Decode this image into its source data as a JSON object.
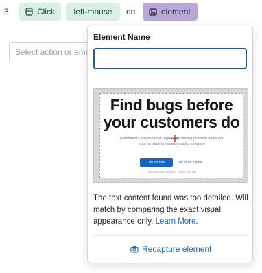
{
  "step": {
    "number": "3",
    "click_label": "Click",
    "mouse_label": "left-mouse",
    "on_label": "on",
    "element_label": "element"
  },
  "action_select": {
    "placeholder": "Select action or emi"
  },
  "popover": {
    "title": "Element Name",
    "name_value": "",
    "preview": {
      "headline": "Find bugs before your customers do",
      "subtext": "Rainforest's cloud-based regression testing platform helps you stay on track to release quality software.",
      "cta_primary": "Try for free",
      "cta_secondary": "Talk to an expert",
      "footnote": "No credit card required · Setup free trial"
    },
    "description_text": "The text content found was too detailed. Will match by comparing the exact visual appearance only.",
    "learn_more": "Learn More",
    "period": ".",
    "recapture_label": "Recapture element"
  },
  "icons": {
    "click": "mouse-click-icon",
    "element": "image-icon",
    "recapture": "camera-icon"
  },
  "colors": {
    "chip_green": "#d9f0e3",
    "chip_purple": "#b7a8d6",
    "input_focus": "#1e5a99",
    "link": "#1e6bb8"
  }
}
